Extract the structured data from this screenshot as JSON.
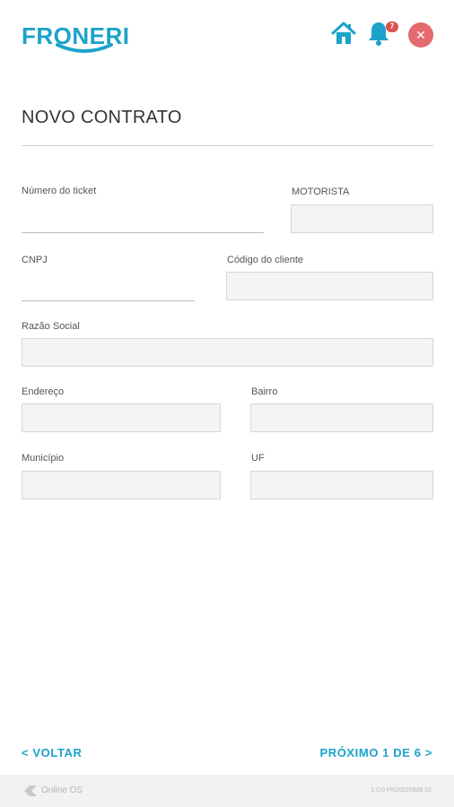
{
  "header": {
    "logo_text": "FRONERI",
    "notification_count": "7"
  },
  "page": {
    "title": "NOVO CONTRATO"
  },
  "form": {
    "ticket_label": "Número do ticket",
    "driver_label": "MOTORISTA",
    "cnpj_label": "CNPJ",
    "client_code_label": "Código do cliente",
    "company_name_label": "Razão Social",
    "address_label": "Endereço",
    "district_label": "Bairro",
    "city_label": "Município",
    "state_label": "UF"
  },
  "navigation": {
    "back_label": "< VOLTAR",
    "next_label": "PRÓXIMO 1 DE 6 >"
  },
  "footer": {
    "brand": "Online OS",
    "version": "1.0.0 FR20220808.02"
  },
  "colors": {
    "accent": "#1ba3c9",
    "close": "#e46a6f",
    "badge": "#d9534f"
  }
}
